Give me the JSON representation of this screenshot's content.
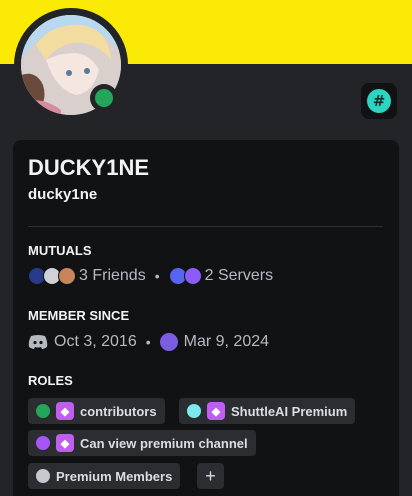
{
  "profile": {
    "display_name": "DUCKY1NE",
    "username": "ducky1ne",
    "status": "online",
    "status_color": "#23a55a",
    "banner_color": "#fbea05",
    "badge_icon": "hashtag-badge-icon",
    "badge_glyph": "#"
  },
  "mutuals": {
    "title": "MUTUALS",
    "friends_label": "3 Friends",
    "servers_label": "2 Servers"
  },
  "member_since": {
    "title": "MEMBER SINCE",
    "discord_date": "Oct 3, 2016",
    "server_date": "Mar 9, 2024",
    "separator": "•"
  },
  "roles": {
    "title": "ROLES",
    "items": [
      {
        "label": "contributors",
        "color": "#23a55a",
        "icon": "role-diamond-icon"
      },
      {
        "label": "ShuttleAI Premium",
        "color": "#7ee8f0",
        "icon": "role-diamond-icon"
      },
      {
        "label": "Can view premium channel",
        "color": "#a855f7",
        "icon": "role-diamond-icon"
      },
      {
        "label": "Premium Members",
        "color": "#c7c9ce",
        "icon": ""
      }
    ],
    "add_label": "+"
  }
}
